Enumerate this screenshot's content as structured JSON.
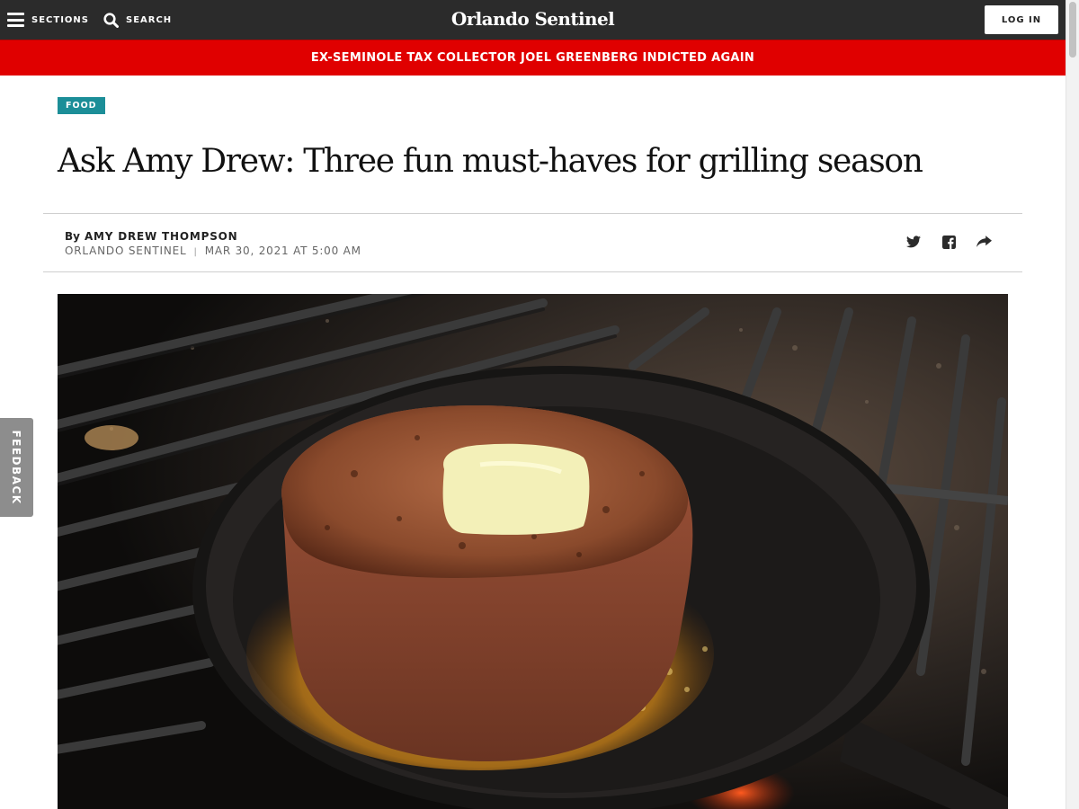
{
  "nav": {
    "sections_label": "SECTIONS",
    "search_label": "SEARCH",
    "logo": "Orlando Sentinel",
    "login_label": "LOG IN"
  },
  "breaking": {
    "text": "EX-SEMINOLE TAX COLLECTOR JOEL GREENBERG INDICTED AGAIN"
  },
  "article": {
    "category": "FOOD",
    "headline": "Ask Amy Drew: Three fun must-haves for grilling season",
    "byline_prefix": "By",
    "author": "AMY DREW THOMPSON",
    "publication": "ORLANDO SENTINEL",
    "separator": "|",
    "date": "MAR 30, 2021 AT 5:00 AM"
  },
  "share": {
    "icons": [
      "twitter-icon",
      "facebook-icon",
      "share-icon"
    ]
  },
  "feedback": {
    "label": "FEEDBACK"
  },
  "colors": {
    "topbar": "#2b2b2b",
    "breaking": "#e00000",
    "category": "#1c8e98",
    "feedback": "#8d8d8d"
  }
}
